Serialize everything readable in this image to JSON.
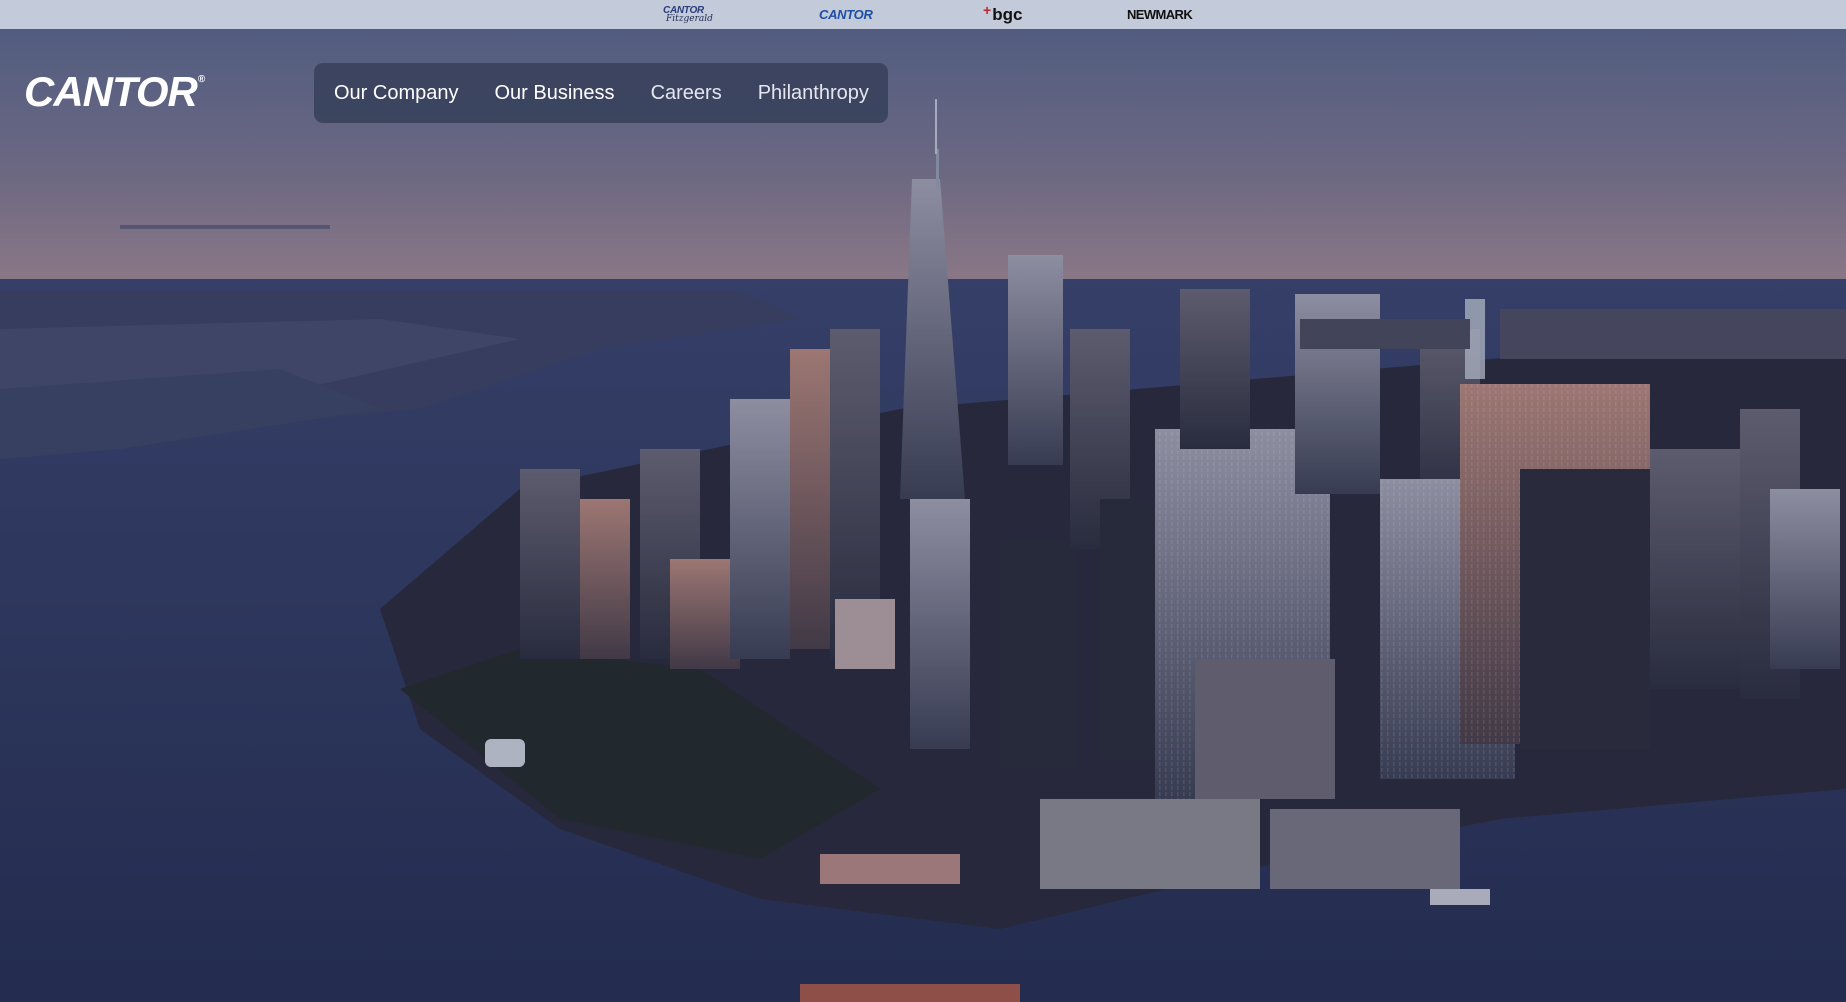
{
  "topbar": {
    "brands": [
      {
        "name": "cantor-fitzgerald",
        "line1": "CANTOR",
        "line2": "Fitzgerald"
      },
      {
        "name": "cantor",
        "label": "CANTOR"
      },
      {
        "name": "bgc",
        "label": "bgc",
        "mark": "+"
      },
      {
        "name": "newmark",
        "label": "NEWMARK"
      }
    ]
  },
  "header": {
    "logo": "CANTOR",
    "logo_mark": "®",
    "nav": [
      {
        "label": "Our Company"
      },
      {
        "label": "Our Business"
      },
      {
        "label": "Careers"
      },
      {
        "label": "Philanthropy"
      }
    ]
  },
  "colors": {
    "topbar_bg": "#c3cad9",
    "nav_bg": "#3a425c",
    "sky_top": "#5e6a8e",
    "sky_horizon": "#a68c96",
    "water": "#2e3a62"
  },
  "icons": {
    "hero": "city-skyline-image"
  }
}
